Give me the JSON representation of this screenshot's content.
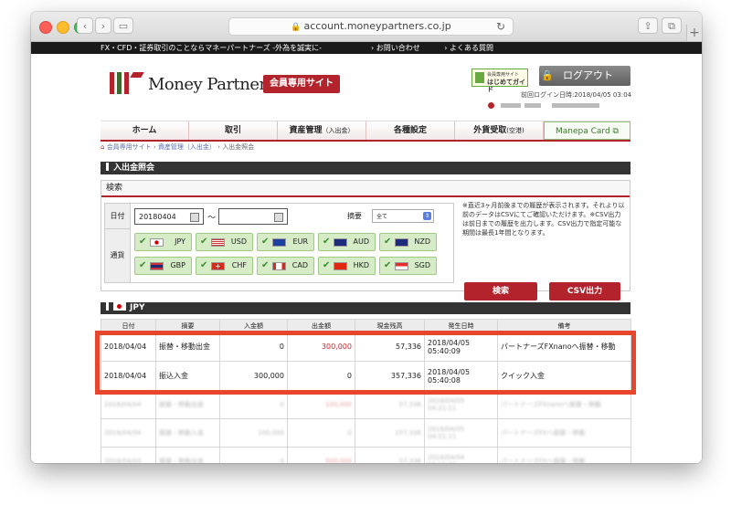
{
  "browser": {
    "url": "account.moneypartners.co.jp"
  },
  "header": {
    "tagline": "FX・CFD・証券取引のことならマネーパートナーズ -外為を誠実に-",
    "links": [
      "お問い合わせ",
      "よくある質問"
    ],
    "logo_text": "Money Partners",
    "member_badge": "会員専用サイト",
    "guide_line1": "会員専用サイト",
    "guide_line2": "はじめてガイド",
    "logout_label": "ログアウト",
    "last_login": "前回ログイン日時:2018/04/05 03:04"
  },
  "nav": {
    "items": [
      {
        "label": "ホーム",
        "sub": ""
      },
      {
        "label": "取引",
        "sub": ""
      },
      {
        "label": "資産管理",
        "sub": "（入出金）"
      },
      {
        "label": "各種設定",
        "sub": ""
      },
      {
        "label": "外貨受取",
        "sub": "(空港)"
      },
      {
        "label": "Manepa Card",
        "sub": ""
      }
    ]
  },
  "breadcrumb": {
    "items": [
      "会員専用サイト",
      "資産管理（入出金）",
      "入出金照会"
    ]
  },
  "page_title": "入出金照会",
  "search": {
    "heading": "検索",
    "date_label": "日付",
    "date_from": "20180404",
    "date_to": "",
    "tilde": "〜",
    "tekiyo_label": "摘要",
    "tekiyo_value": "全て",
    "currency_label": "通貨",
    "currencies": [
      "JPY",
      "USD",
      "EUR",
      "AUD",
      "NZD",
      "GBP",
      "CHF",
      "CAD",
      "HKD",
      "SGD"
    ],
    "note": "※直近3ヶ月前後までの履歴が表示されます。それより以前のデータはCSVにてご確認いただけます。※CSV出力は前日までの履歴を出力します。CSV出力で指定可能な期間は最長1年間となります。",
    "search_button": "検索",
    "csv_button": "CSV出力"
  },
  "results": {
    "currency": "JPY",
    "columns": [
      "日付",
      "摘要",
      "入金額",
      "出金額",
      "現金残高",
      "発生日時",
      "備考"
    ],
    "rows": [
      [
        "2018/04/04",
        "振替・移動出金",
        "0",
        "300,000",
        "57,336",
        "2018/04/05 05:40:09",
        "パートナーズFXnanoへ振替・移動"
      ],
      [
        "2018/04/04",
        "振込入金",
        "300,000",
        "0",
        "357,336",
        "2018/04/05 05:40:08",
        "クイック入金"
      ],
      [
        "2018/04/04",
        "振替・移動出金",
        "0",
        "100,000",
        "57,336",
        "2018/04/05 04:21:11",
        "パートナーズFXnanoへ振替・移動"
      ],
      [
        "2018/04/04",
        "振替・移動入金",
        "100,000",
        "0",
        "157,336",
        "2018/04/05 04:21:11",
        "パートナーズFXへ振替・移動"
      ],
      [
        "2018/04/03",
        "振替・移動出金",
        "0",
        "500,000",
        "57,336",
        "2018/04/04 03:10:24",
        "パートナーズFXへ振替・移動"
      ]
    ]
  },
  "colors": {
    "brand_red": "#b3232b",
    "highlight": "#e8452d",
    "currency_green": "#d5ecc7"
  }
}
